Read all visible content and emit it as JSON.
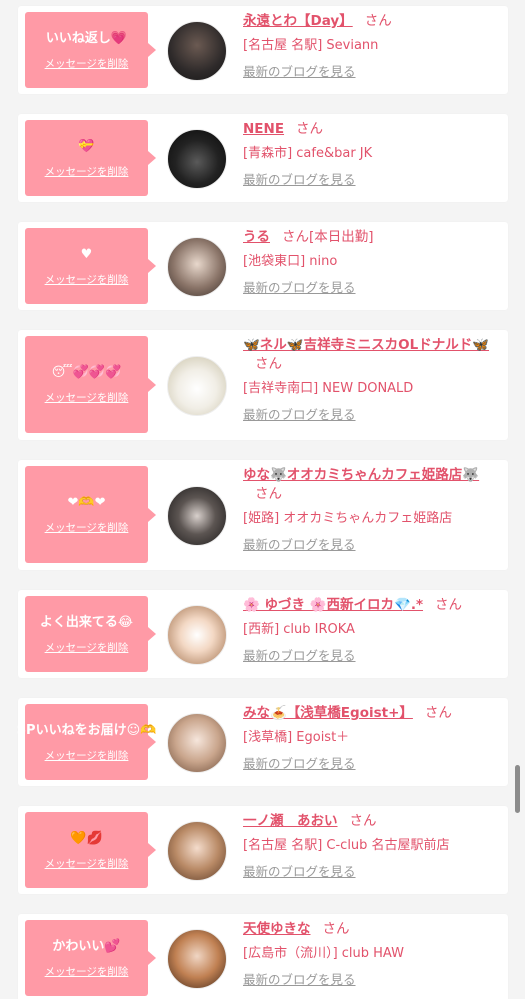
{
  "common": {
    "delete_label": "メッセージを削除",
    "blog_label": "最新のブログを見る",
    "san": "さん"
  },
  "colors": {
    "accent": "#e2526b",
    "message_box": "#ff9aa6",
    "card": "#ffffff",
    "background": "#f4f4f4"
  },
  "items": [
    {
      "message": "いいね返し💗",
      "name": "永遠とわ【Day】",
      "suffix": "",
      "area": "[名古屋 名駅] Seviann",
      "avatar_icon": "profile-photo"
    },
    {
      "message": "💝",
      "name": "NENE",
      "suffix": "",
      "area": "[青森市] cafe&bar JK",
      "avatar_icon": "profile-photo"
    },
    {
      "message": "♥",
      "name": "うる",
      "suffix": "[本日出勤]",
      "area": "[池袋東口] nino",
      "avatar_icon": "profile-photo"
    },
    {
      "message": "😴💞💞💞",
      "name": "🦋ネル🦋吉祥寺ミニスカOLドナルド🦋",
      "suffix": "",
      "area": "[吉祥寺南口] NEW DONALD",
      "avatar_icon": "profile-photo"
    },
    {
      "message": "❤🫶❤",
      "name": "ゆな🐺オオカミちゃんカフェ姫路店🐺",
      "suffix": "",
      "area": "[姫路] オオカミちゃんカフェ姫路店",
      "avatar_icon": "profile-photo"
    },
    {
      "message": "よく出来てる😂",
      "name": "🌸 ゆづき 🌸西新イロカ💎.*",
      "suffix": "",
      "area": "[西新] club IROKA",
      "avatar_icon": "profile-photo"
    },
    {
      "message": "SPいいねをお届け☺🫶",
      "name": "みな🍝【浅草橋Egoist+】",
      "suffix": "",
      "area": "[浅草橋] Egoist＋",
      "avatar_icon": "profile-photo"
    },
    {
      "message": "🧡💋",
      "name": "一ノ瀬　あおい",
      "suffix": "",
      "area": "[名古屋 名駅] C-club 名古屋駅前店",
      "avatar_icon": "profile-photo"
    },
    {
      "message": "かわいい💕",
      "name": "天使ゆきな",
      "suffix": "",
      "area": "[広島市（流川）] club HAW",
      "avatar_icon": "profile-photo"
    }
  ]
}
